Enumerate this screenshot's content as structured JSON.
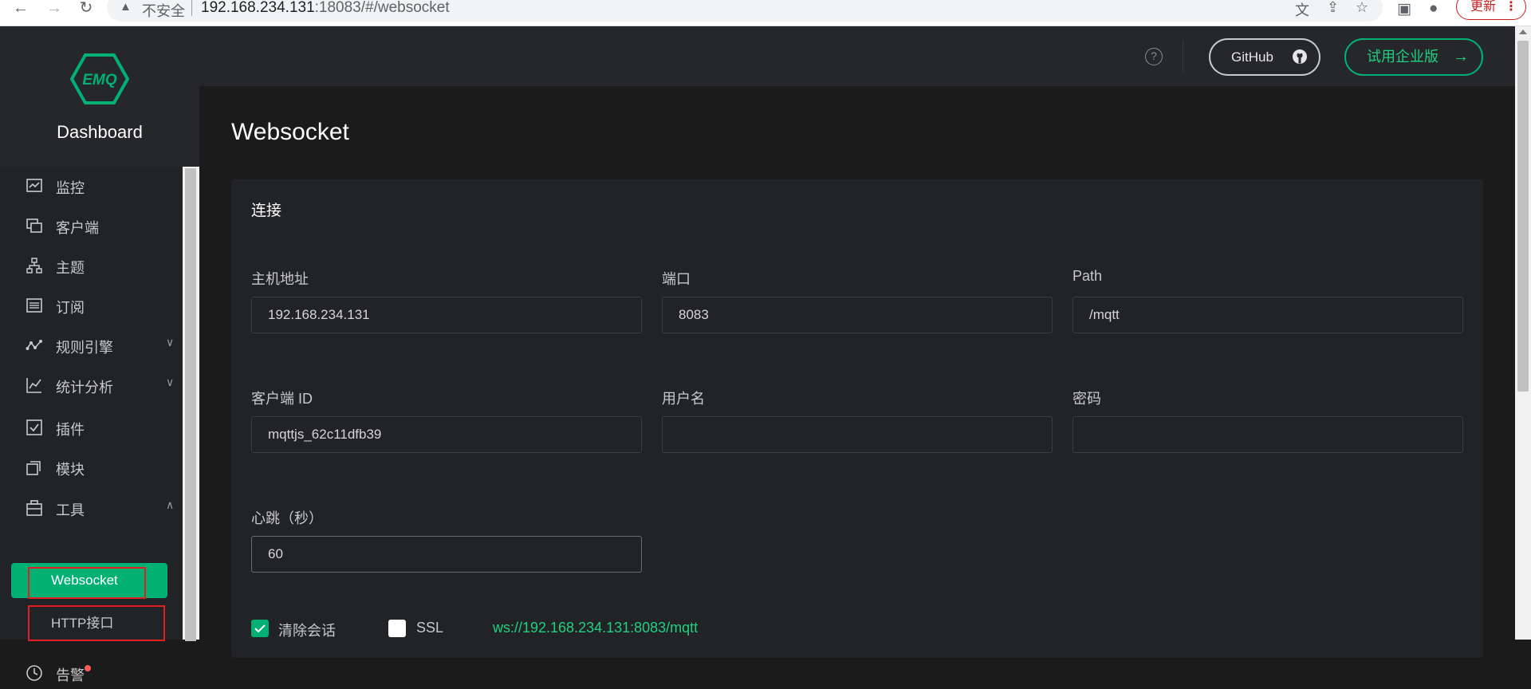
{
  "browser": {
    "back": "←",
    "forward": "→",
    "reload": "↻",
    "security_warning": "不安全",
    "url_host": "192.168.234.131",
    "url_rest": ":18083/#/websocket",
    "update_label": "更新"
  },
  "sidebar": {
    "app_title": "Dashboard",
    "logo_text": "EMQ",
    "items": [
      {
        "label": "监控",
        "icon": "monitor-icon"
      },
      {
        "label": "客户端",
        "icon": "clients-icon"
      },
      {
        "label": "主题",
        "icon": "topics-icon"
      },
      {
        "label": "订阅",
        "icon": "subscriptions-icon"
      },
      {
        "label": "规则引擎",
        "icon": "rule-engine-icon"
      },
      {
        "label": "统计分析",
        "icon": "analysis-icon"
      },
      {
        "label": "插件",
        "icon": "plugins-icon"
      },
      {
        "label": "模块",
        "icon": "modules-icon"
      },
      {
        "label": "工具",
        "icon": "tools-icon"
      }
    ],
    "sub_items": [
      {
        "label": "Websocket"
      },
      {
        "label": "HTTP接口"
      }
    ],
    "partial_item": "告警"
  },
  "header": {
    "help": "?",
    "github_label": "GitHub",
    "enterprise_label": "试用企业版",
    "enterprise_arrow": "→",
    "accent_color": "#00b173"
  },
  "main": {
    "page_title": "Websocket",
    "card_title": "连接",
    "fields": {
      "host": {
        "label": "主机地址",
        "value": "192.168.234.131"
      },
      "port": {
        "label": "端口",
        "value": "8083"
      },
      "path": {
        "label": "Path",
        "value": "/mqtt"
      },
      "client_id": {
        "label": "客户端 ID",
        "value": "mqttjs_62c11dfb39"
      },
      "username": {
        "label": "用户名",
        "value": ""
      },
      "password": {
        "label": "密码",
        "value": ""
      },
      "keepalive": {
        "label": "心跳（秒）",
        "value": "60"
      }
    },
    "clean_session": {
      "label": "清除会话",
      "checked": true
    },
    "ssl": {
      "label": "SSL",
      "checked": false
    },
    "ws_url": "ws://192.168.234.131:8083/mqtt"
  }
}
